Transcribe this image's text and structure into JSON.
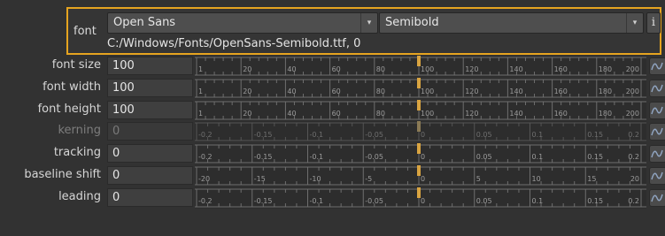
{
  "font": {
    "label": "font",
    "family": "Open Sans",
    "style": "Semibold",
    "info_label": "i",
    "path": "C:/Windows/Fonts/OpenSans-Semibold.ttf, 0"
  },
  "rows": [
    {
      "label": "font size",
      "value": "100",
      "enabled": true,
      "slider": {
        "min": 0,
        "max": 200,
        "marker": 100,
        "ticks": [
          "1",
          "20",
          "40",
          "60",
          "80",
          "100",
          "120",
          "140",
          "160",
          "180",
          "200"
        ]
      }
    },
    {
      "label": "font width",
      "value": "100",
      "enabled": true,
      "slider": {
        "min": 0,
        "max": 200,
        "marker": 100,
        "ticks": [
          "1",
          "20",
          "40",
          "60",
          "80",
          "100",
          "120",
          "140",
          "160",
          "180",
          "200"
        ]
      }
    },
    {
      "label": "font height",
      "value": "100",
      "enabled": true,
      "slider": {
        "min": 0,
        "max": 200,
        "marker": 100,
        "ticks": [
          "1",
          "20",
          "40",
          "60",
          "80",
          "100",
          "120",
          "140",
          "160",
          "180",
          "200"
        ]
      }
    },
    {
      "label": "kerning",
      "value": "0",
      "enabled": false,
      "slider": {
        "min": -0.2,
        "max": 0.2,
        "marker": 0,
        "ticks": [
          "-0.2",
          "-0.15",
          "-0.1",
          "-0.05",
          "0",
          "0.05",
          "0.1",
          "0.15",
          "0.2"
        ]
      }
    },
    {
      "label": "tracking",
      "value": "0",
      "enabled": true,
      "slider": {
        "min": -0.2,
        "max": 0.2,
        "marker": 0,
        "ticks": [
          "-0.2",
          "-0.15",
          "-0.1",
          "-0.05",
          "0",
          "0.05",
          "0.1",
          "0.15",
          "0.2"
        ]
      }
    },
    {
      "label": "baseline shift",
      "value": "0",
      "enabled": true,
      "slider": {
        "min": -20,
        "max": 20,
        "marker": 0,
        "ticks": [
          "-20",
          "-15",
          "-10",
          "-5",
          "0",
          "5",
          "10",
          "15",
          "20"
        ]
      }
    },
    {
      "label": "leading",
      "value": "0",
      "enabled": true,
      "slider": {
        "min": -0.2,
        "max": 0.2,
        "marker": 0,
        "ticks": [
          "-0.2",
          "-0.15",
          "-0.1",
          "-0.05",
          "0",
          "0.05",
          "0.1",
          "0.15",
          "0.2"
        ]
      }
    }
  ],
  "colors": {
    "highlight_border": "#e6a420",
    "slider_marker": "#d9a441",
    "animation_icon": "#8fa3bf"
  },
  "icons": {
    "dropdown": "dropdown-arrow-icon",
    "animation": "animation-curve-icon"
  }
}
